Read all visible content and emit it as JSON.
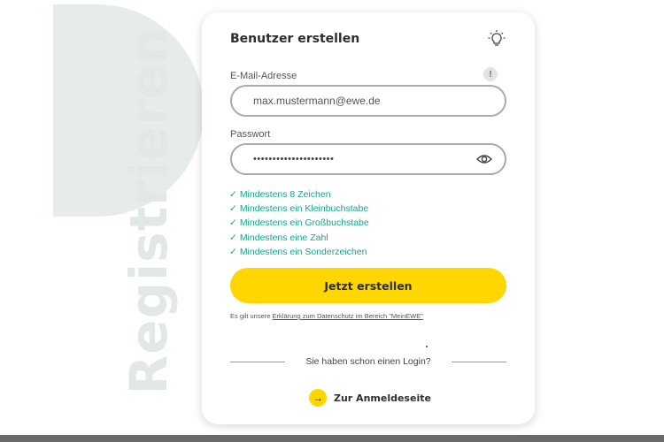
{
  "side_word": "Registrieren",
  "card": {
    "title": "Benutzer erstellen",
    "email": {
      "label": "E-Mail-Adresse",
      "value": "max.mustermann@ewe.de",
      "info_icon": "!"
    },
    "password": {
      "label": "Passwort",
      "value": "•••••••••••••••••••••"
    },
    "rules": [
      "Mindestens 8 Zeichen",
      "Mindestens ein Kleinbuchstabe",
      "Mindestens ein Großbuchstabe",
      "Mindestens eine Zahl",
      "Mindestens ein Sonderzeichen"
    ],
    "check_mark": "✓",
    "submit_label": "Jetzt erstellen",
    "privacy": {
      "prefix": "Es gilt unsere ",
      "link": "Erklärung zum Datenschutz im Bereich \"MeinEWE\""
    },
    "login_question": "Sie haben schon einen Login?",
    "goto_login": {
      "icon": "→",
      "label": "Zur Anmeldeseite"
    }
  },
  "colors": {
    "accent": "#ffd600",
    "success": "#1aa38c",
    "field_border": "#aaaaaa",
    "side_word": "#e2e8e6"
  },
  "icons": [
    "lightbulb-icon",
    "info-icon",
    "eye-icon",
    "arrow-right-icon"
  ]
}
